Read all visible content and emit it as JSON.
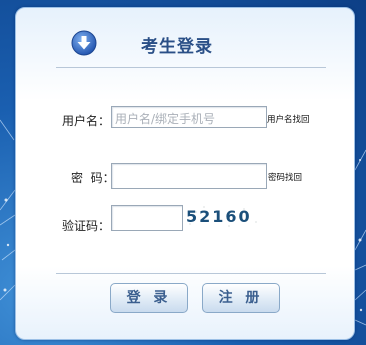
{
  "header": {
    "title": "考生登录",
    "icon": "download-arrow-icon"
  },
  "form": {
    "username": {
      "label": "用户名：",
      "placeholder": "用户名/绑定手机号",
      "link": "用户名找回"
    },
    "password": {
      "label": "密  码：",
      "value": "",
      "link": "密码找回"
    },
    "captcha": {
      "label": "验证码：",
      "value": "",
      "code": "52160"
    }
  },
  "buttons": {
    "login": "登 录",
    "register": "注 册"
  },
  "colors": {
    "accent": "#2a4f87",
    "background": "#1a5fb0",
    "icon": "#3b6fc7"
  }
}
